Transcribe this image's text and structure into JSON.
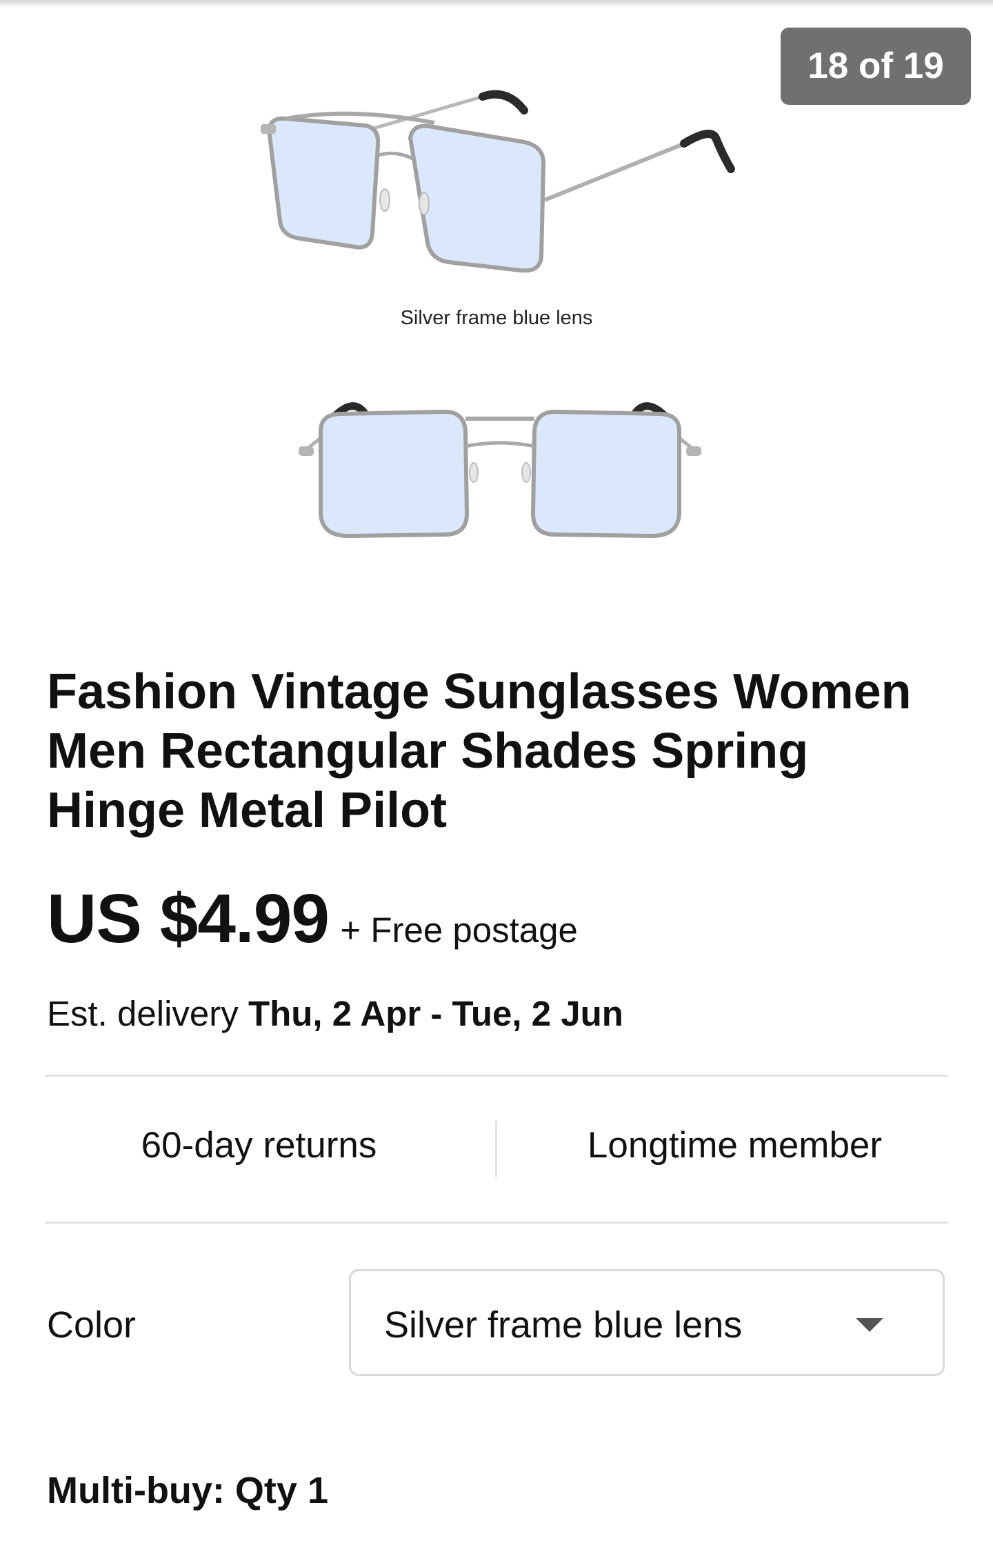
{
  "gallery": {
    "counter": "18 of 19",
    "caption": "Silver frame blue lens",
    "images": [
      "sunglasses-angled-view",
      "sunglasses-front-view"
    ]
  },
  "product": {
    "title": "Fashion Vintage Sunglasses Women Men Rectangular Shades Spring Hinge Metal Pilot",
    "price": "US $4.99",
    "postage": "+ Free postage",
    "delivery_prefix": "Est. delivery",
    "delivery_dates": "Thu, 2 Apr - Tue, 2 Jun"
  },
  "features": {
    "returns": "60-day returns",
    "seller": "Longtime member"
  },
  "variation": {
    "label": "Color",
    "selected": "Silver frame blue lens"
  },
  "multibuy": {
    "label": "Multi-buy: Qty 1"
  },
  "colors": {
    "lens": "#dbe8fb",
    "frame": "#a9a9a9",
    "counter_bg": "#707070"
  }
}
